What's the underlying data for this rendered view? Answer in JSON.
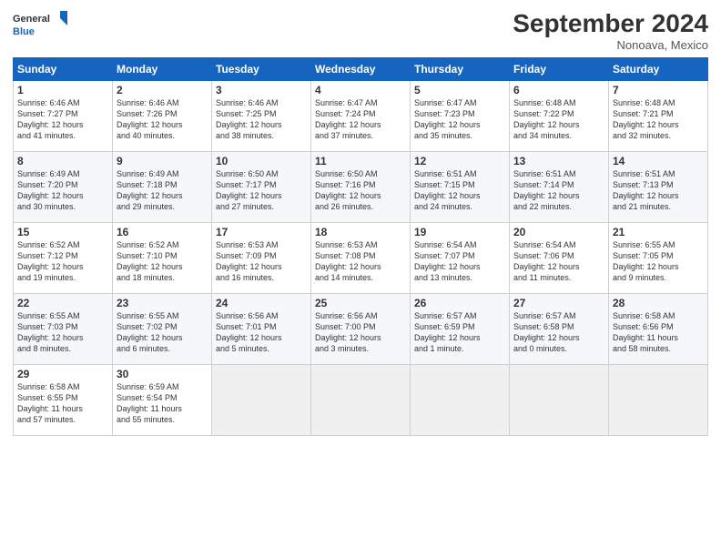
{
  "header": {
    "logo_line1": "General",
    "logo_line2": "Blue",
    "month": "September 2024",
    "location": "Nonoava, Mexico"
  },
  "weekdays": [
    "Sunday",
    "Monday",
    "Tuesday",
    "Wednesday",
    "Thursday",
    "Friday",
    "Saturday"
  ],
  "weeks": [
    [
      {
        "day": "1",
        "info": "Sunrise: 6:46 AM\nSunset: 7:27 PM\nDaylight: 12 hours\nand 41 minutes."
      },
      {
        "day": "2",
        "info": "Sunrise: 6:46 AM\nSunset: 7:26 PM\nDaylight: 12 hours\nand 40 minutes."
      },
      {
        "day": "3",
        "info": "Sunrise: 6:46 AM\nSunset: 7:25 PM\nDaylight: 12 hours\nand 38 minutes."
      },
      {
        "day": "4",
        "info": "Sunrise: 6:47 AM\nSunset: 7:24 PM\nDaylight: 12 hours\nand 37 minutes."
      },
      {
        "day": "5",
        "info": "Sunrise: 6:47 AM\nSunset: 7:23 PM\nDaylight: 12 hours\nand 35 minutes."
      },
      {
        "day": "6",
        "info": "Sunrise: 6:48 AM\nSunset: 7:22 PM\nDaylight: 12 hours\nand 34 minutes."
      },
      {
        "day": "7",
        "info": "Sunrise: 6:48 AM\nSunset: 7:21 PM\nDaylight: 12 hours\nand 32 minutes."
      }
    ],
    [
      {
        "day": "8",
        "info": "Sunrise: 6:49 AM\nSunset: 7:20 PM\nDaylight: 12 hours\nand 30 minutes."
      },
      {
        "day": "9",
        "info": "Sunrise: 6:49 AM\nSunset: 7:18 PM\nDaylight: 12 hours\nand 29 minutes."
      },
      {
        "day": "10",
        "info": "Sunrise: 6:50 AM\nSunset: 7:17 PM\nDaylight: 12 hours\nand 27 minutes."
      },
      {
        "day": "11",
        "info": "Sunrise: 6:50 AM\nSunset: 7:16 PM\nDaylight: 12 hours\nand 26 minutes."
      },
      {
        "day": "12",
        "info": "Sunrise: 6:51 AM\nSunset: 7:15 PM\nDaylight: 12 hours\nand 24 minutes."
      },
      {
        "day": "13",
        "info": "Sunrise: 6:51 AM\nSunset: 7:14 PM\nDaylight: 12 hours\nand 22 minutes."
      },
      {
        "day": "14",
        "info": "Sunrise: 6:51 AM\nSunset: 7:13 PM\nDaylight: 12 hours\nand 21 minutes."
      }
    ],
    [
      {
        "day": "15",
        "info": "Sunrise: 6:52 AM\nSunset: 7:12 PM\nDaylight: 12 hours\nand 19 minutes."
      },
      {
        "day": "16",
        "info": "Sunrise: 6:52 AM\nSunset: 7:10 PM\nDaylight: 12 hours\nand 18 minutes."
      },
      {
        "day": "17",
        "info": "Sunrise: 6:53 AM\nSunset: 7:09 PM\nDaylight: 12 hours\nand 16 minutes."
      },
      {
        "day": "18",
        "info": "Sunrise: 6:53 AM\nSunset: 7:08 PM\nDaylight: 12 hours\nand 14 minutes."
      },
      {
        "day": "19",
        "info": "Sunrise: 6:54 AM\nSunset: 7:07 PM\nDaylight: 12 hours\nand 13 minutes."
      },
      {
        "day": "20",
        "info": "Sunrise: 6:54 AM\nSunset: 7:06 PM\nDaylight: 12 hours\nand 11 minutes."
      },
      {
        "day": "21",
        "info": "Sunrise: 6:55 AM\nSunset: 7:05 PM\nDaylight: 12 hours\nand 9 minutes."
      }
    ],
    [
      {
        "day": "22",
        "info": "Sunrise: 6:55 AM\nSunset: 7:03 PM\nDaylight: 12 hours\nand 8 minutes."
      },
      {
        "day": "23",
        "info": "Sunrise: 6:55 AM\nSunset: 7:02 PM\nDaylight: 12 hours\nand 6 minutes."
      },
      {
        "day": "24",
        "info": "Sunrise: 6:56 AM\nSunset: 7:01 PM\nDaylight: 12 hours\nand 5 minutes."
      },
      {
        "day": "25",
        "info": "Sunrise: 6:56 AM\nSunset: 7:00 PM\nDaylight: 12 hours\nand 3 minutes."
      },
      {
        "day": "26",
        "info": "Sunrise: 6:57 AM\nSunset: 6:59 PM\nDaylight: 12 hours\nand 1 minute."
      },
      {
        "day": "27",
        "info": "Sunrise: 6:57 AM\nSunset: 6:58 PM\nDaylight: 12 hours\nand 0 minutes."
      },
      {
        "day": "28",
        "info": "Sunrise: 6:58 AM\nSunset: 6:56 PM\nDaylight: 11 hours\nand 58 minutes."
      }
    ],
    [
      {
        "day": "29",
        "info": "Sunrise: 6:58 AM\nSunset: 6:55 PM\nDaylight: 11 hours\nand 57 minutes."
      },
      {
        "day": "30",
        "info": "Sunrise: 6:59 AM\nSunset: 6:54 PM\nDaylight: 11 hours\nand 55 minutes."
      },
      {
        "day": "",
        "info": ""
      },
      {
        "day": "",
        "info": ""
      },
      {
        "day": "",
        "info": ""
      },
      {
        "day": "",
        "info": ""
      },
      {
        "day": "",
        "info": ""
      }
    ]
  ]
}
